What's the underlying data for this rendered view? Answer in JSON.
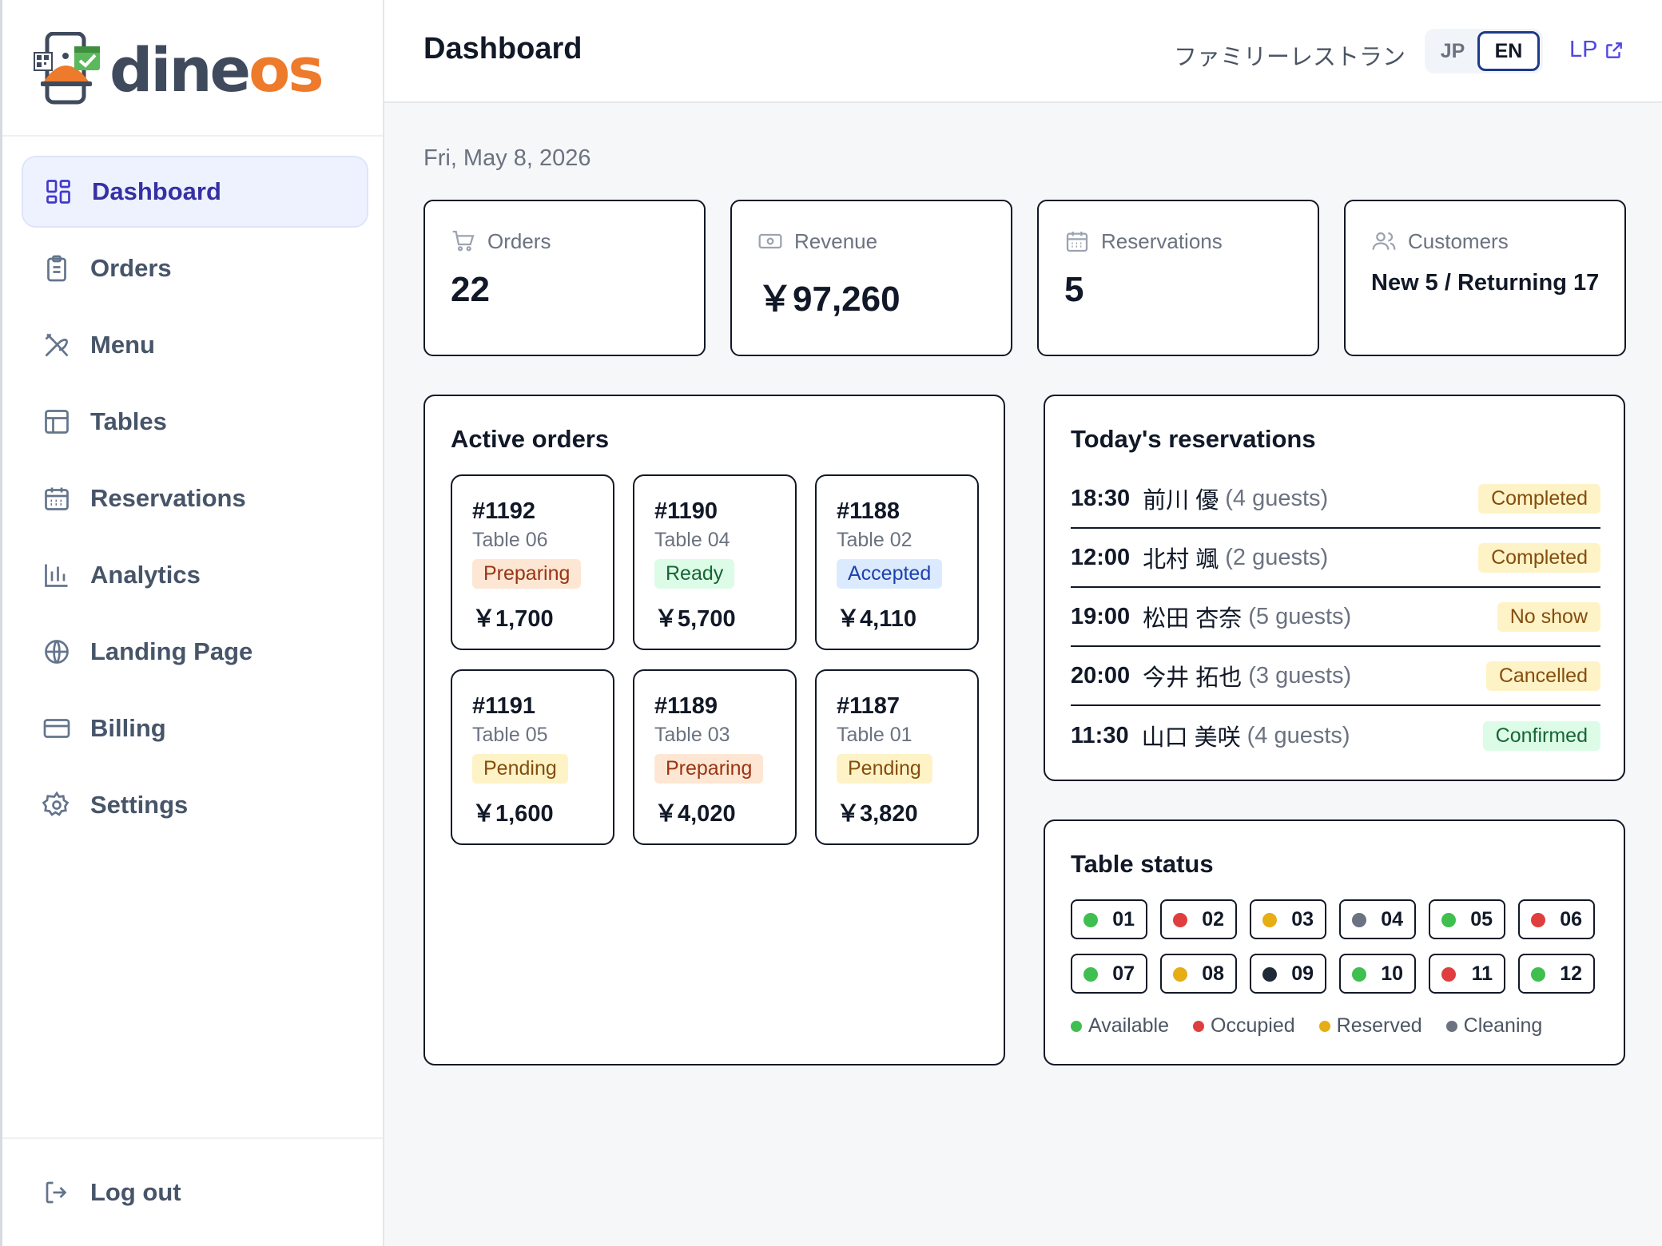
{
  "brand": {
    "name_part1": "dine",
    "name_part2": "os"
  },
  "nav": {
    "items": [
      {
        "label": "Dashboard",
        "icon": "dashboard-icon",
        "active": true
      },
      {
        "label": "Orders",
        "icon": "clipboard-icon"
      },
      {
        "label": "Menu",
        "icon": "utensils-icon"
      },
      {
        "label": "Tables",
        "icon": "table-icon"
      },
      {
        "label": "Reservations",
        "icon": "calendar-icon"
      },
      {
        "label": "Analytics",
        "icon": "bar-chart-icon"
      },
      {
        "label": "Landing Page",
        "icon": "globe-icon"
      },
      {
        "label": "Billing",
        "icon": "credit-card-icon"
      },
      {
        "label": "Settings",
        "icon": "gear-icon"
      }
    ],
    "logout_label": "Log out"
  },
  "header": {
    "title": "Dashboard",
    "restaurant_name": "ファミリーレストラン",
    "lang_jp": "JP",
    "lang_en": "EN",
    "lang_selected": "EN",
    "lp_link": "LP"
  },
  "date": "Fri, May 8, 2026",
  "stats": [
    {
      "label": "Orders",
      "value": "22",
      "icon": "cart-icon"
    },
    {
      "label": "Revenue",
      "value": "￥97,260",
      "icon": "banknote-icon"
    },
    {
      "label": "Reservations",
      "value": "5",
      "icon": "calendar-icon"
    },
    {
      "label": "Customers",
      "value": "New 5 / Returning 17",
      "icon": "users-icon"
    }
  ],
  "active_orders": {
    "title": "Active orders",
    "orders": [
      {
        "number": "#1192",
        "table": "Table 06",
        "status": "Preparing",
        "amount": "￥1,700"
      },
      {
        "number": "#1190",
        "table": "Table 04",
        "status": "Ready",
        "amount": "￥5,700"
      },
      {
        "number": "#1188",
        "table": "Table 02",
        "status": "Accepted",
        "amount": "￥4,110"
      },
      {
        "number": "#1191",
        "table": "Table 05",
        "status": "Pending",
        "amount": "￥1,600"
      },
      {
        "number": "#1189",
        "table": "Table 03",
        "status": "Preparing",
        "amount": "￥4,020"
      },
      {
        "number": "#1187",
        "table": "Table 01",
        "status": "Pending",
        "amount": "￥3,820"
      }
    ]
  },
  "reservations": {
    "title": "Today's reservations",
    "items": [
      {
        "time": "18:30",
        "name": "前川 優",
        "guests": "(4 guests)",
        "status": "Completed"
      },
      {
        "time": "12:00",
        "name": "北村 颯",
        "guests": "(2 guests)",
        "status": "Completed"
      },
      {
        "time": "19:00",
        "name": "松田 杏奈",
        "guests": "(5 guests)",
        "status": "No show"
      },
      {
        "time": "20:00",
        "name": "今井 拓也",
        "guests": "(3 guests)",
        "status": "Cancelled"
      },
      {
        "time": "11:30",
        "name": "山口 美咲",
        "guests": "(4 guests)",
        "status": "Confirmed"
      }
    ]
  },
  "table_status": {
    "title": "Table status",
    "tables": [
      {
        "id": "01",
        "state": "available"
      },
      {
        "id": "02",
        "state": "occupied"
      },
      {
        "id": "03",
        "state": "reserved"
      },
      {
        "id": "04",
        "state": "cleaning"
      },
      {
        "id": "05",
        "state": "available"
      },
      {
        "id": "06",
        "state": "occupied"
      },
      {
        "id": "07",
        "state": "available"
      },
      {
        "id": "08",
        "state": "reserved"
      },
      {
        "id": "09",
        "state": "dark"
      },
      {
        "id": "10",
        "state": "available"
      },
      {
        "id": "11",
        "state": "occupied"
      },
      {
        "id": "12",
        "state": "available"
      }
    ],
    "legend": [
      {
        "label": "Available",
        "state": "available"
      },
      {
        "label": "Occupied",
        "state": "occupied"
      },
      {
        "label": "Reserved",
        "state": "reserved"
      },
      {
        "label": "Cleaning",
        "state": "cleaning"
      }
    ]
  },
  "colors": {
    "available": "#3fbf4f",
    "occupied": "#e03e3e",
    "reserved": "#e6ad14",
    "cleaning": "#6b7280",
    "dark": "#1f2937",
    "accent": "#4f46e5",
    "brand_orange": "#ee7a2b"
  }
}
